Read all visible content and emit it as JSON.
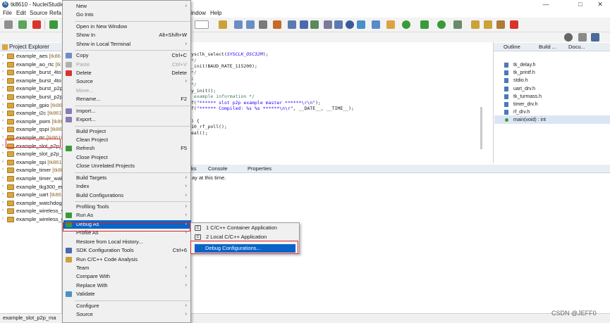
{
  "window": {
    "title": "tk8610 - NucleiStudio",
    "controls": [
      "—",
      "□",
      "✕"
    ]
  },
  "menubar": {
    "items": [
      "File",
      "Edit",
      "Source",
      "Refa",
      "indow",
      "Help"
    ]
  },
  "project_explorer": {
    "tab_label": "Project Explorer",
    "projects": [
      {
        "name": "example_aes",
        "suffix": "[tk86"
      },
      {
        "name": "example_ao_rtc",
        "suffix": "[tk"
      },
      {
        "name": "example_burst_4to",
        "suffix": ""
      },
      {
        "name": "example_burst_4to",
        "suffix": ""
      },
      {
        "name": "example_burst_p2p",
        "suffix": ""
      },
      {
        "name": "example_burst_p2p",
        "suffix": ""
      },
      {
        "name": "example_gpio",
        "suffix": "[tk86"
      },
      {
        "name": "example_i2c",
        "suffix": "[tk861"
      },
      {
        "name": "example_pwm",
        "suffix": "[tk86"
      },
      {
        "name": "example_qspi",
        "suffix": "[tk86"
      },
      {
        "name": "example_rtc",
        "suffix": "[tk8610"
      },
      {
        "name": "example_slot_p2p_r",
        "suffix": ""
      },
      {
        "name": "example_slot_p2p_",
        "suffix": ""
      },
      {
        "name": "example_spi",
        "suffix": "[tk861"
      },
      {
        "name": "example_timer",
        "suffix": "[tk86"
      },
      {
        "name": "example_timer_wak",
        "suffix": ""
      },
      {
        "name": "example_tkg300_er",
        "suffix": ""
      },
      {
        "name": "example_uart",
        "suffix": "[tk86"
      },
      {
        "name": "example_watchdog",
        "suffix": ""
      },
      {
        "name": "example_wireless_v",
        "suffix": ""
      },
      {
        "name": "example_wireless_w",
        "suffix": ""
      }
    ]
  },
  "context_menu": {
    "items": [
      {
        "label": "New",
        "accel": "",
        "submenu": true,
        "disabled": false,
        "icon": ""
      },
      {
        "label": "Go Into",
        "accel": "",
        "submenu": false,
        "disabled": false,
        "icon": ""
      },
      {
        "sep": true
      },
      {
        "label": "Open in New Window",
        "accel": "",
        "submenu": false,
        "disabled": false,
        "icon": ""
      },
      {
        "label": "Show In",
        "accel": "Alt+Shift+W",
        "submenu": true,
        "disabled": false,
        "icon": ""
      },
      {
        "label": "Show in Local Terminal",
        "accel": "",
        "submenu": true,
        "disabled": false,
        "icon": ""
      },
      {
        "sep": true
      },
      {
        "label": "Copy",
        "accel": "Ctrl+C",
        "submenu": false,
        "disabled": false,
        "icon": "copy-icon"
      },
      {
        "label": "Paste",
        "accel": "Ctrl+V",
        "submenu": false,
        "disabled": true,
        "icon": "paste-icon"
      },
      {
        "label": "Delete",
        "accel": "Delete",
        "submenu": false,
        "disabled": false,
        "icon": "delete-icon"
      },
      {
        "label": "Source",
        "accel": "",
        "submenu": true,
        "disabled": false,
        "icon": ""
      },
      {
        "label": "Move...",
        "accel": "",
        "submenu": false,
        "disabled": true,
        "icon": ""
      },
      {
        "label": "Rename...",
        "accel": "F2",
        "submenu": false,
        "disabled": false,
        "icon": ""
      },
      {
        "sep": true
      },
      {
        "label": "Import...",
        "accel": "",
        "submenu": false,
        "disabled": false,
        "icon": "import-icon"
      },
      {
        "label": "Export...",
        "accel": "",
        "submenu": false,
        "disabled": false,
        "icon": "export-icon"
      },
      {
        "sep": true
      },
      {
        "label": "Build Project",
        "accel": "",
        "submenu": false,
        "disabled": false,
        "icon": ""
      },
      {
        "label": "Clean Project",
        "accel": "",
        "submenu": false,
        "disabled": false,
        "icon": ""
      },
      {
        "label": "Refresh",
        "accel": "F5",
        "submenu": false,
        "disabled": false,
        "icon": "refresh-icon"
      },
      {
        "label": "Close Project",
        "accel": "",
        "submenu": false,
        "disabled": false,
        "icon": ""
      },
      {
        "label": "Close Unrelated Projects",
        "accel": "",
        "submenu": false,
        "disabled": false,
        "icon": ""
      },
      {
        "sep": true
      },
      {
        "label": "Build Targets",
        "accel": "",
        "submenu": true,
        "disabled": false,
        "icon": ""
      },
      {
        "label": "Index",
        "accel": "",
        "submenu": true,
        "disabled": false,
        "icon": ""
      },
      {
        "label": "Build Configurations",
        "accel": "",
        "submenu": true,
        "disabled": false,
        "icon": ""
      },
      {
        "sep": true
      },
      {
        "label": "Profiling Tools",
        "accel": "",
        "submenu": true,
        "disabled": false,
        "icon": ""
      },
      {
        "label": "Run As",
        "accel": "",
        "submenu": true,
        "disabled": false,
        "icon": "run-icon"
      },
      {
        "label": "Debug As",
        "accel": "",
        "submenu": true,
        "disabled": false,
        "icon": "debug-icon",
        "active": true
      },
      {
        "label": "Profile As",
        "accel": "",
        "submenu": true,
        "disabled": false,
        "icon": ""
      },
      {
        "label": "Restore from Local History...",
        "accel": "",
        "submenu": false,
        "disabled": false,
        "icon": ""
      },
      {
        "label": "SDK Configuration Tools",
        "accel": "Ctrl+6",
        "submenu": false,
        "disabled": false,
        "icon": "sdk-icon"
      },
      {
        "label": "Run C/C++ Code Analysis",
        "accel": "",
        "submenu": false,
        "disabled": false,
        "icon": "analysis-icon"
      },
      {
        "label": "Team",
        "accel": "",
        "submenu": true,
        "disabled": false,
        "icon": ""
      },
      {
        "label": "Compare With",
        "accel": "",
        "submenu": true,
        "disabled": false,
        "icon": ""
      },
      {
        "label": "Replace With",
        "accel": "",
        "submenu": true,
        "disabled": false,
        "icon": ""
      },
      {
        "label": "Validate",
        "accel": "",
        "submenu": false,
        "disabled": false,
        "icon": "validate-icon"
      },
      {
        "sep": true
      },
      {
        "label": "Configure",
        "accel": "",
        "submenu": true,
        "disabled": false,
        "icon": ""
      },
      {
        "label": "Source",
        "accel": "",
        "submenu": true,
        "disabled": false,
        "icon": ""
      }
    ]
  },
  "debug_submenu": {
    "items": [
      {
        "label": "1 C/C++ Container Application",
        "icon_text": "C"
      },
      {
        "label": "2 Local C/C++ Application",
        "icon_text": "C"
      },
      {
        "label": "Debug Configurations...",
        "active": true
      }
    ]
  },
  "editor": {
    "lines": [
      {
        "parts": [
          {
            "t": "ysclk_select(",
            "c": ""
          },
          {
            "t": "SYSCLK_OSC32M",
            "c": "it"
          },
          {
            "t": ");",
            "c": ""
          }
        ]
      },
      {
        "parts": [
          {
            "t": "*/",
            "c": "cm"
          }
        ]
      },
      {
        "parts": [
          {
            "t": "_init(BAUD_RATE_115200);",
            "c": ""
          }
        ]
      },
      {
        "parts": [
          {
            "t": "*/",
            "c": "cm"
          }
        ]
      },
      {
        "parts": [
          {
            "t": ";",
            "c": ""
          }
        ]
      },
      {
        "parts": [
          {
            "t": "*/",
            "c": "cm"
          }
        ]
      },
      {
        "parts": [
          {
            "t": "y_init();",
            "c": ""
          }
        ]
      },
      {
        "parts": [
          {
            "t": " example information */",
            "c": "cm"
          }
        ]
      },
      {
        "parts": [
          {
            "t": "f(",
            "c": ""
          },
          {
            "t": "\"****** slot p2p example master ******\\r\\n\"",
            "c": "str"
          },
          {
            "t": ");",
            "c": ""
          }
        ]
      },
      {
        "parts": [
          {
            "t": "f(",
            "c": ""
          },
          {
            "t": "\"****** Compiled: %s %s ******\\n\\r\"",
            "c": "str"
          },
          {
            "t": ", __DATE__, __TIME__);",
            "c": ""
          }
        ]
      },
      {
        "parts": [
          {
            "t": "",
            "c": ""
          }
        ]
      },
      {
        "parts": [
          {
            "t": ") {",
            "c": ""
          }
        ]
      },
      {
        "parts": [
          {
            "t": "10_rf_poll();",
            "c": ""
          }
        ]
      },
      {
        "parts": [
          {
            "t": "eal();",
            "c": ""
          }
        ]
      }
    ]
  },
  "outline": {
    "tabs": [
      "Outline",
      "Build ...",
      "Docu..."
    ],
    "items": [
      {
        "label": "tk_delay.h",
        "kind": "header"
      },
      {
        "label": "tk_printf.h",
        "kind": "header"
      },
      {
        "label": "stdio.h",
        "kind": "header"
      },
      {
        "label": "uart_drv.h",
        "kind": "header"
      },
      {
        "label": "tk_turmass.h",
        "kind": "header"
      },
      {
        "label": "timer_drv.h",
        "kind": "header"
      },
      {
        "label": "rf_drv.h",
        "kind": "header"
      },
      {
        "label": "main(void) : int",
        "kind": "function"
      }
    ]
  },
  "bottom_panel": {
    "tabs": [
      "ks",
      "Console",
      "Properties"
    ],
    "message": "ay at this time."
  },
  "statusbar": {
    "text": "example_slot_p2p_ma"
  },
  "watermark": "CSDN @JEFF0",
  "colors": {
    "highlight_red": "#d9262b",
    "menu_active": "#0a64c8"
  }
}
